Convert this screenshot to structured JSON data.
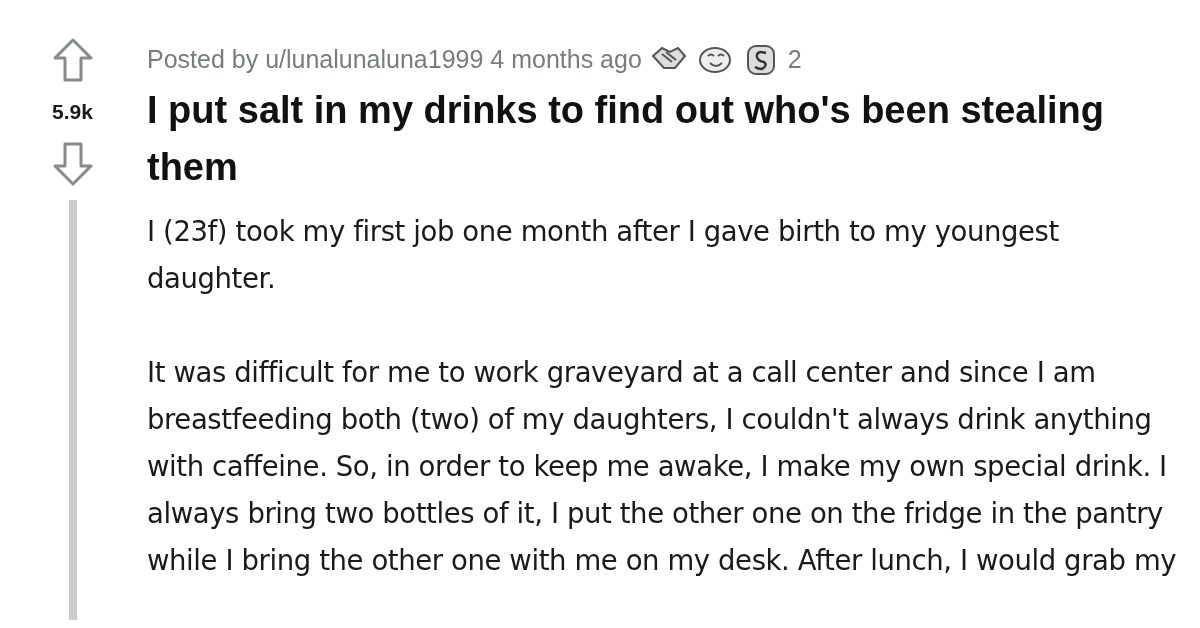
{
  "post": {
    "author_line": "Posted by u/lunalunaluna1999 4 months ago",
    "awards": [
      {
        "kind": "handshake"
      },
      {
        "kind": "face"
      },
      {
        "kind": "coin"
      }
    ],
    "award_count": "2",
    "score": "5.9k",
    "title": "I put salt in my drinks to find out who's been stealing them",
    "paragraphs": [
      "I (23f) took my first job one month after I gave birth to my youngest daughter.",
      "It was difficult for me to work graveyard at a call center and since I am breastfeeding both (two) of my daughters, I couldn't always drink anything with caffeine. So, in order to keep me awake, I make my own special drink. I always bring two bottles of it, I put the other one on the fridge in the pantry while I bring the other one with me on my desk. After lunch, I would grab my"
    ]
  }
}
